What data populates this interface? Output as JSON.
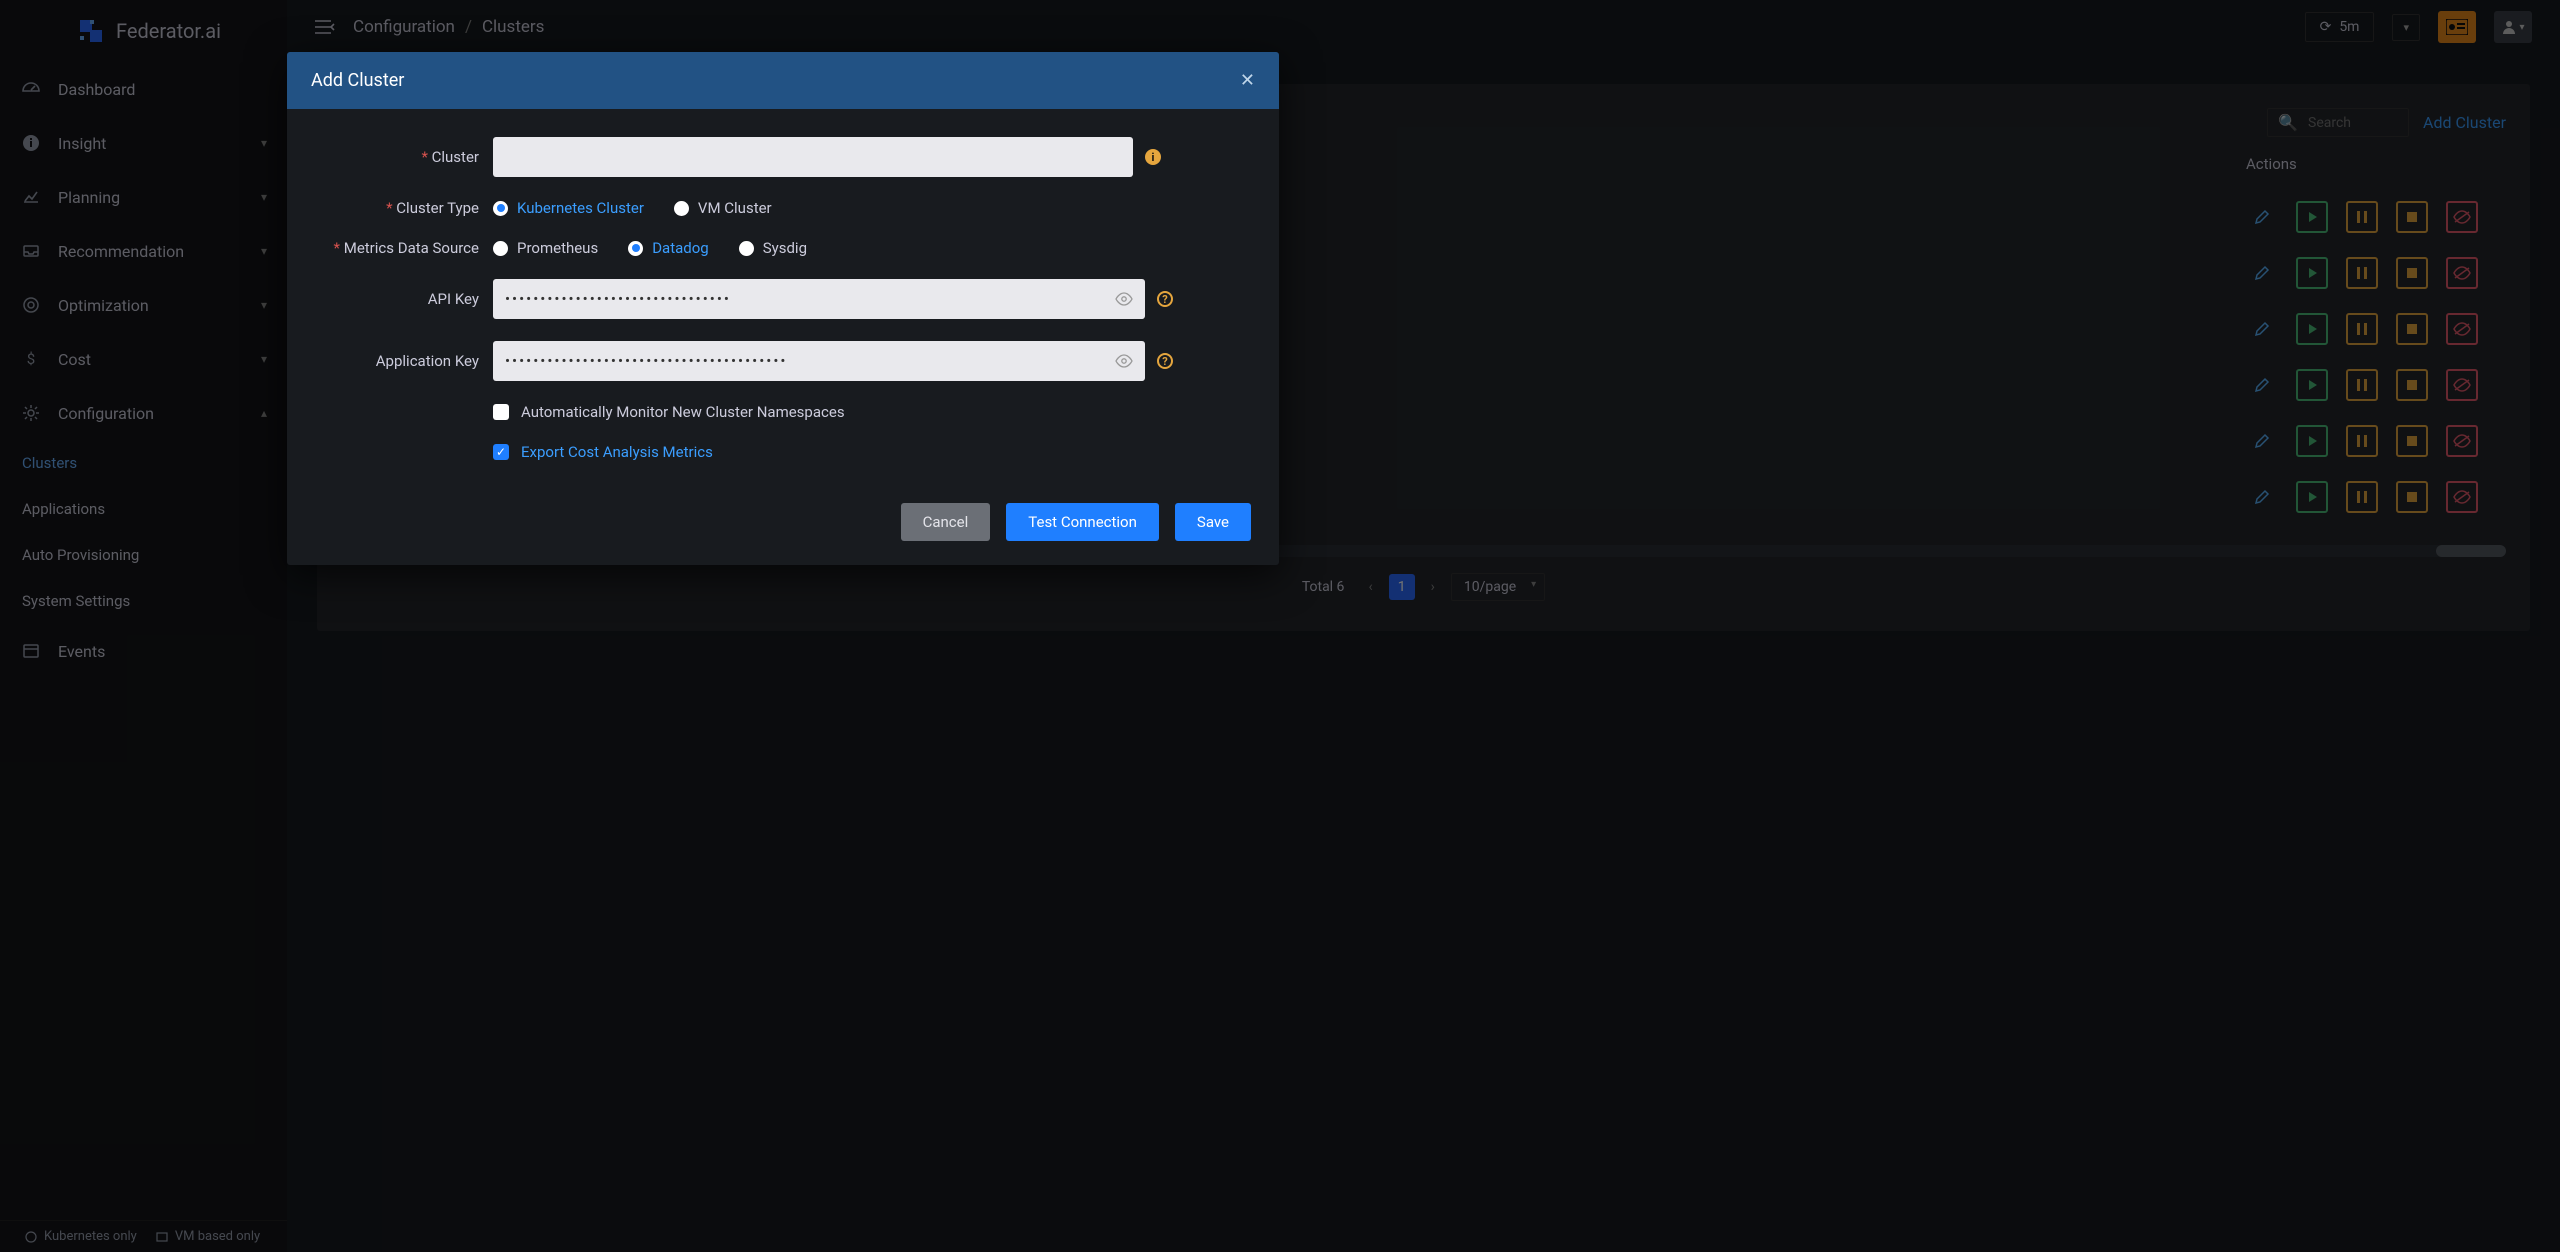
{
  "brand": "Federator.ai",
  "sidebar": {
    "items": [
      {
        "label": "Dashboard",
        "expandable": false
      },
      {
        "label": "Insight",
        "expandable": true
      },
      {
        "label": "Planning",
        "expandable": true
      },
      {
        "label": "Recommendation",
        "expandable": true
      },
      {
        "label": "Optimization",
        "expandable": true
      },
      {
        "label": "Cost",
        "expandable": true
      },
      {
        "label": "Configuration",
        "expandable": true,
        "open": true,
        "children": [
          {
            "label": "Clusters",
            "active": true
          },
          {
            "label": "Applications"
          },
          {
            "label": "Auto Provisioning"
          },
          {
            "label": "System Settings"
          }
        ]
      },
      {
        "label": "Events",
        "expandable": false
      }
    ],
    "footer": [
      "Kubernetes only",
      "VM based only"
    ]
  },
  "breadcrumb": [
    "Configuration",
    "Clusters"
  ],
  "time_range": "5m",
  "search_placeholder": "Search",
  "add_cluster_link": "Add Cluster",
  "actions_header": "Actions",
  "row_count": 6,
  "pager": {
    "total_label": "Total 6",
    "page": "1",
    "per_page": "10/page"
  },
  "modal": {
    "title": "Add Cluster",
    "fields": {
      "cluster_label": "Cluster",
      "cluster_value": "",
      "cluster_type_label": "Cluster Type",
      "cluster_type_options": [
        "Kubernetes Cluster",
        "VM Cluster"
      ],
      "cluster_type_selected": "Kubernetes Cluster",
      "metrics_label": "Metrics Data Source",
      "metrics_options": [
        "Prometheus",
        "Datadog",
        "Sysdig"
      ],
      "metrics_selected": "Datadog",
      "api_key_label": "API Key",
      "api_key_value": "••••••••••••••••••••••••••••••••",
      "app_key_label": "Application Key",
      "app_key_value": "••••••••••••••••••••••••••••••••••••••••",
      "auto_monitor_label": "Automatically Monitor New Cluster Namespaces",
      "auto_monitor_checked": false,
      "export_cost_label": "Export Cost Analysis Metrics",
      "export_cost_checked": true
    },
    "buttons": {
      "cancel": "Cancel",
      "test": "Test Connection",
      "save": "Save"
    }
  }
}
